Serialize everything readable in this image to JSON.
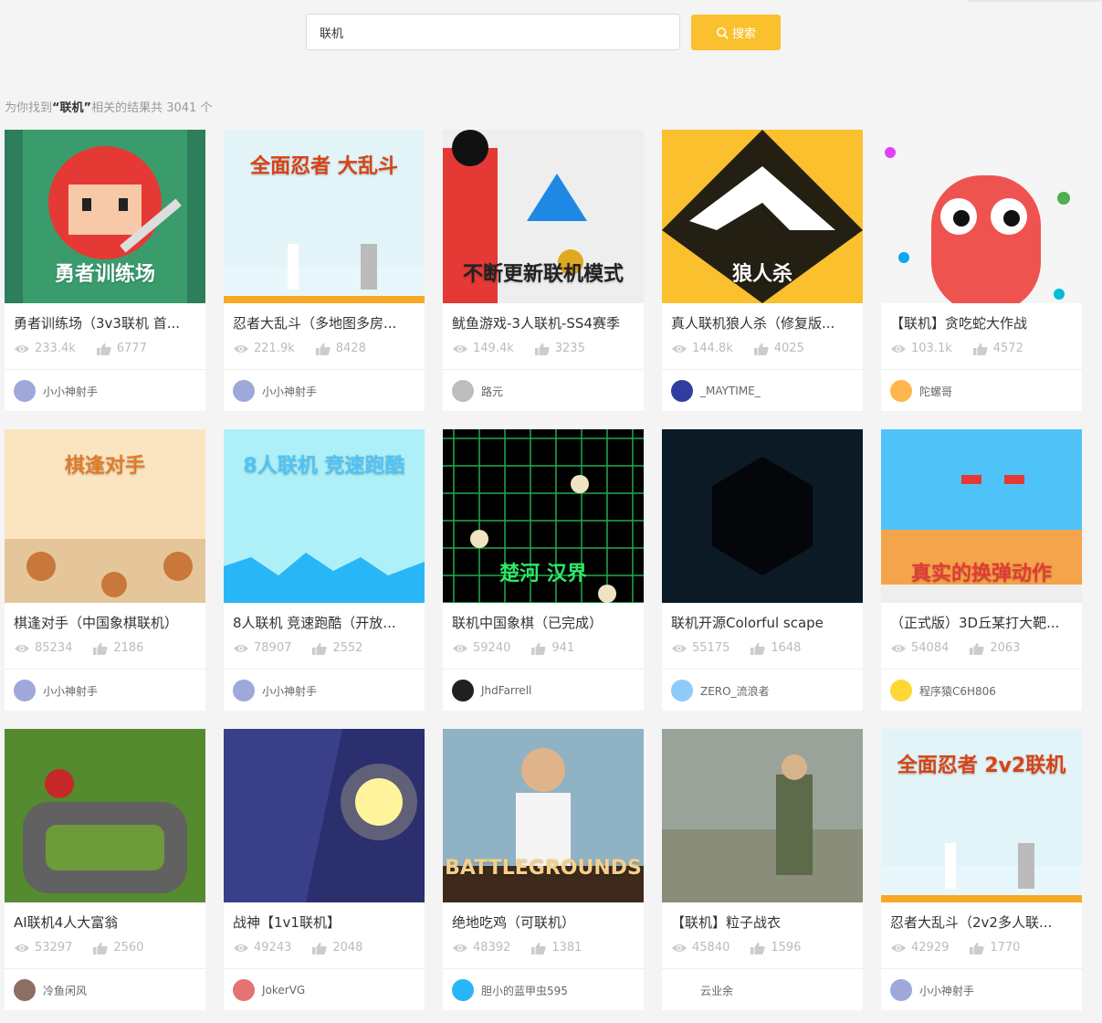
{
  "search": {
    "value": "联机",
    "button_label": "搜索"
  },
  "summary": {
    "prefix": "为你找到",
    "keyword": "“联机”",
    "suffix": "相关的结果共 3041 个"
  },
  "cards": [
    {
      "title": "勇者训练场（3v3联机 首...",
      "views": "233.4k",
      "likes": "6777",
      "author": "小小神射手",
      "bg": "#2e7d5b",
      "accent": "#e53935",
      "avatar": "#9fa8da",
      "thumb_text": "勇者训练场",
      "thumb_text_color": "#ffffff"
    },
    {
      "title": "忍者大乱斗（多地图多房...",
      "views": "221.9k",
      "likes": "8428",
      "author": "小小神射手",
      "bg": "#e3f4f8",
      "accent": "#f9a825",
      "avatar": "#9fa8da",
      "thumb_text": "全面忍者 大乱斗",
      "thumb_text_color": "#d84315"
    },
    {
      "title": "鱿鱼游戏-3人联机-SS4赛季",
      "views": "149.4k",
      "likes": "3235",
      "author": "路元",
      "bg": "#eeeeee",
      "accent": "#e53935",
      "avatar": "#bdbdbd",
      "thumb_text": "不断更新联机模式",
      "thumb_text_color": "#222222"
    },
    {
      "title": "真人联机狼人杀（修复版...",
      "views": "144.8k",
      "likes": "4025",
      "author": "_MAYTIME_",
      "bg": "#fbc02d",
      "accent": "#111111",
      "avatar": "#303f9f",
      "thumb_text": "狼人杀",
      "thumb_text_color": "#ffffff"
    },
    {
      "title": "【联机】贪吃蛇大作战",
      "views": "103.1k",
      "likes": "4572",
      "author": "陀螺哥",
      "bg": "#f5f5f5",
      "accent": "#ef5350",
      "avatar": "#ffb74d",
      "thumb_text": "",
      "thumb_text_color": "#ffffff"
    },
    {
      "title": "棋逢对手（中国象棋联机）",
      "views": "85234",
      "likes": "2186",
      "author": "小小神射手",
      "bg": "#fbe5c0",
      "accent": "#c9773a",
      "avatar": "#9fa8da",
      "thumb_text": "棋逢对手",
      "thumb_text_color": "#e07b2a"
    },
    {
      "title": "8人联机 竞速跑酷（开放...",
      "views": "78907",
      "likes": "2552",
      "author": "小小神射手",
      "bg": "#aef0f7",
      "accent": "#29b6f6",
      "avatar": "#9fa8da",
      "thumb_text": "8人联机 竞速跑酷",
      "thumb_text_color": "#4fc3f7"
    },
    {
      "title": "联机中国象棋（已完成）",
      "views": "59240",
      "likes": "941",
      "author": "JhdFarrell",
      "bg": "#000000",
      "accent": "#1faa4f",
      "avatar": "#212121",
      "thumb_text": "楚河 汉界",
      "thumb_text_color": "#2ee86a"
    },
    {
      "title": "联机开源Colorful scape",
      "views": "55175",
      "likes": "1648",
      "author": "ZERO_流浪者",
      "bg": "#0b1a24",
      "accent": "#05060a",
      "avatar": "#90caf9",
      "thumb_text": "",
      "thumb_text_color": "#ffffff"
    },
    {
      "title": "（正式版）3D丘某打大靶...",
      "views": "54084",
      "likes": "2063",
      "author": "程序猿C6H806",
      "bg": "#4fc3f7",
      "accent": "#f4a44a",
      "avatar": "#fdd835",
      "thumb_text": "真实的换弹动作",
      "thumb_text_color": "#e53935"
    },
    {
      "title": "AI联机4人大富翁",
      "views": "53297",
      "likes": "2560",
      "author": "冷鱼闲风",
      "bg": "#558b2f",
      "accent": "#616161",
      "avatar": "#8d6e63",
      "thumb_text": "",
      "thumb_text_color": "#ffffff"
    },
    {
      "title": "战神【1v1联机】",
      "views": "49243",
      "likes": "2048",
      "author": "JokerVG",
      "bg": "#2b2f6e",
      "accent": "#fff59d",
      "avatar": "#e57373",
      "thumb_text": "",
      "thumb_text_color": "#ffffff"
    },
    {
      "title": "绝地吃鸡（可联机）",
      "views": "48392",
      "likes": "1381",
      "author": "胆小的蓝甲虫595",
      "bg": "#8fb3c4",
      "accent": "#e0863a",
      "avatar": "#29b6f6",
      "thumb_text": "BATTLEGROUNDS",
      "thumb_text_color": "#f5d08a"
    },
    {
      "title": "【联机】粒子战衣",
      "views": "45840",
      "likes": "1596",
      "author": "云业余",
      "bg": "#9aa39a",
      "accent": "#5d6b4a",
      "avatar": "#ffffff",
      "thumb_text": "",
      "thumb_text_color": "#ffffff"
    },
    {
      "title": "忍者大乱斗（2v2多人联...",
      "views": "42929",
      "likes": "1770",
      "author": "小小神射手",
      "bg": "#e3f4f8",
      "accent": "#f9a825",
      "avatar": "#9fa8da",
      "thumb_text": "全面忍者 2v2联机",
      "thumb_text_color": "#d84315"
    }
  ]
}
